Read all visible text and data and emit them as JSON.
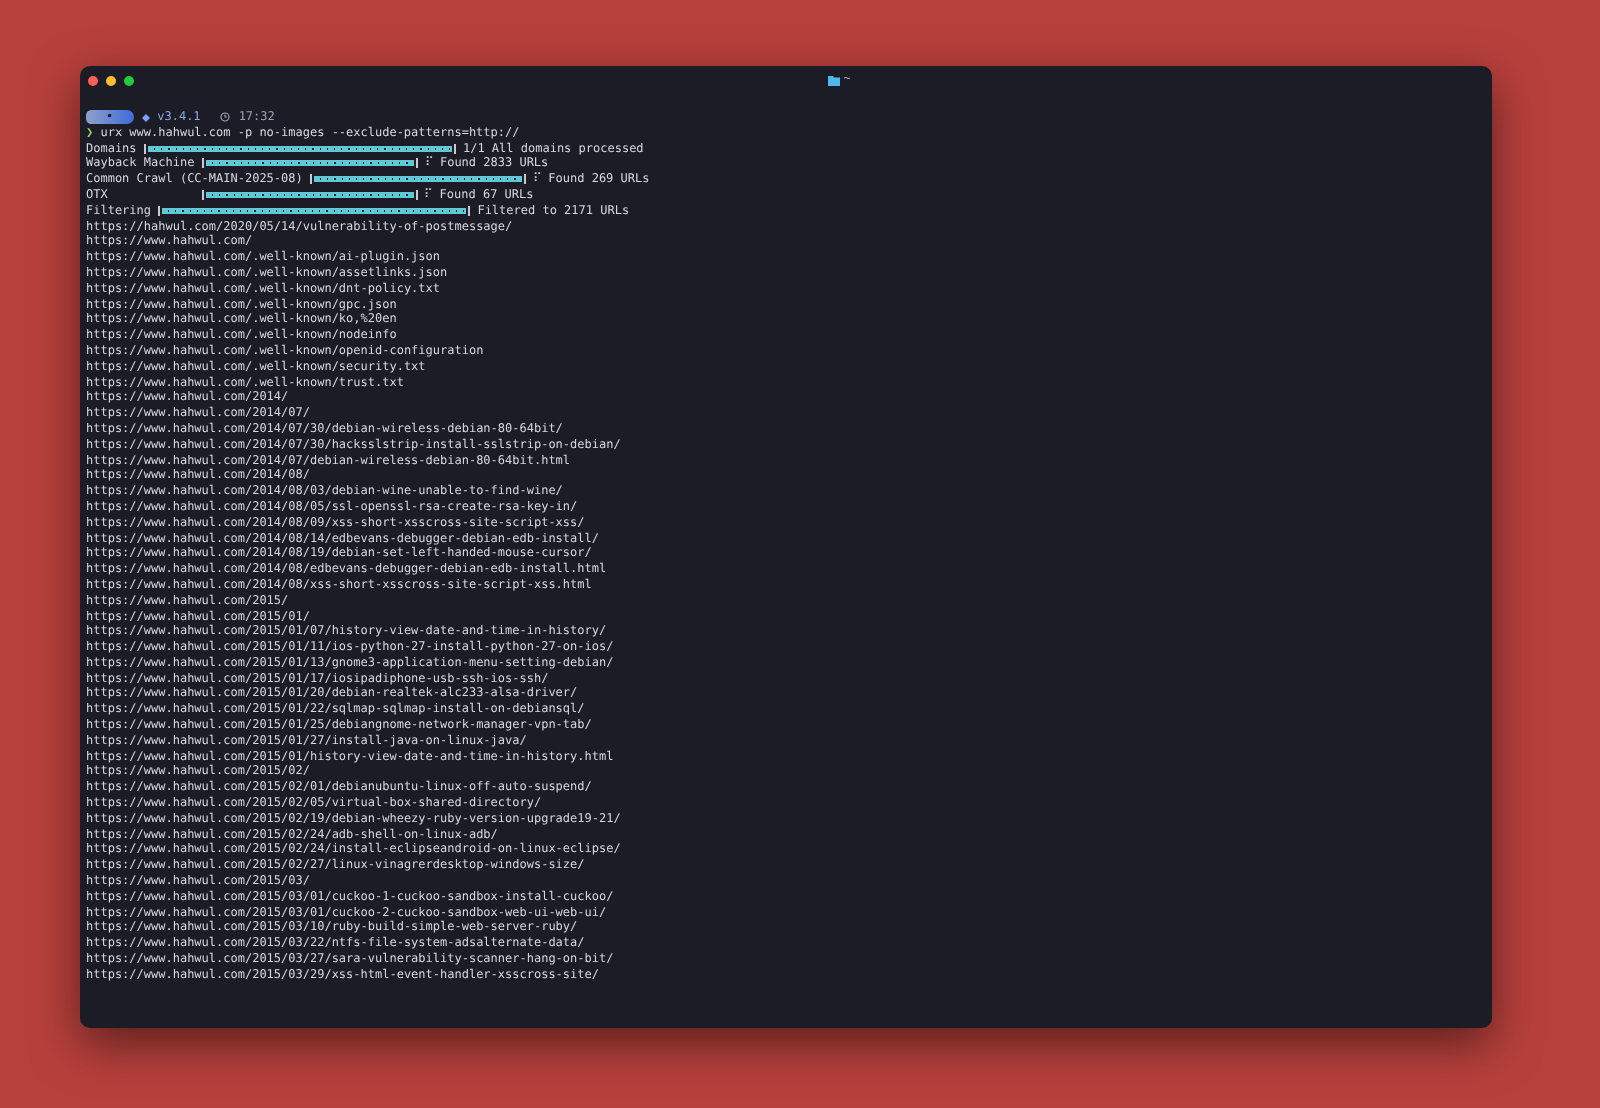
{
  "window": {
    "title": "~"
  },
  "prompt": {
    "segment": "•",
    "version": "v3.4.1",
    "time": "17:32",
    "symbol": "❯",
    "command": "urx www.hahwul.com -p no-images --exclude-patterns=http://"
  },
  "progress": [
    {
      "label": "Domains",
      "level": 1,
      "status": "1/1 All domains processed"
    },
    {
      "label": "Wayback Machine",
      "level": 1,
      "spinner": "⠏",
      "status": "Found 2833 URLs"
    },
    {
      "label": "Common Crawl (CC-MAIN-2025-08)",
      "level": 1,
      "spinner": "⠏",
      "status": "Found 269 URLs"
    },
    {
      "label": "OTX",
      "level": 1,
      "spinner": "⠏",
      "status": "Found 67 URLs"
    },
    {
      "label": "Filtering",
      "level": 1,
      "status": "Filtered to 2171 URLs"
    }
  ],
  "urls": [
    "https://hahwul.com/2020/05/14/vulnerability-of-postmessage/",
    "https://www.hahwul.com/",
    "https://www.hahwul.com/.well-known/ai-plugin.json",
    "https://www.hahwul.com/.well-known/assetlinks.json",
    "https://www.hahwul.com/.well-known/dnt-policy.txt",
    "https://www.hahwul.com/.well-known/gpc.json",
    "https://www.hahwul.com/.well-known/ko,%20en",
    "https://www.hahwul.com/.well-known/nodeinfo",
    "https://www.hahwul.com/.well-known/openid-configuration",
    "https://www.hahwul.com/.well-known/security.txt",
    "https://www.hahwul.com/.well-known/trust.txt",
    "https://www.hahwul.com/2014/",
    "https://www.hahwul.com/2014/07/",
    "https://www.hahwul.com/2014/07/30/debian-wireless-debian-80-64bit/",
    "https://www.hahwul.com/2014/07/30/hacksslstrip-install-sslstrip-on-debian/",
    "https://www.hahwul.com/2014/07/debian-wireless-debian-80-64bit.html",
    "https://www.hahwul.com/2014/08/",
    "https://www.hahwul.com/2014/08/03/debian-wine-unable-to-find-wine/",
    "https://www.hahwul.com/2014/08/05/ssl-openssl-rsa-create-rsa-key-in/",
    "https://www.hahwul.com/2014/08/09/xss-short-xsscross-site-script-xss/",
    "https://www.hahwul.com/2014/08/14/edbevans-debugger-debian-edb-install/",
    "https://www.hahwul.com/2014/08/19/debian-set-left-handed-mouse-cursor/",
    "https://www.hahwul.com/2014/08/edbevans-debugger-debian-edb-install.html",
    "https://www.hahwul.com/2014/08/xss-short-xsscross-site-script-xss.html",
    "https://www.hahwul.com/2015/",
    "https://www.hahwul.com/2015/01/",
    "https://www.hahwul.com/2015/01/07/history-view-date-and-time-in-history/",
    "https://www.hahwul.com/2015/01/11/ios-python-27-install-python-27-on-ios/",
    "https://www.hahwul.com/2015/01/13/gnome3-application-menu-setting-debian/",
    "https://www.hahwul.com/2015/01/17/iosipadiphone-usb-ssh-ios-ssh/",
    "https://www.hahwul.com/2015/01/20/debian-realtek-alc233-alsa-driver/",
    "https://www.hahwul.com/2015/01/22/sqlmap-sqlmap-install-on-debiansql/",
    "https://www.hahwul.com/2015/01/25/debiangnome-network-manager-vpn-tab/",
    "https://www.hahwul.com/2015/01/27/install-java-on-linux-java/",
    "https://www.hahwul.com/2015/01/history-view-date-and-time-in-history.html",
    "https://www.hahwul.com/2015/02/",
    "https://www.hahwul.com/2015/02/01/debianubuntu-linux-off-auto-suspend/",
    "https://www.hahwul.com/2015/02/05/virtual-box-shared-directory/",
    "https://www.hahwul.com/2015/02/19/debian-wheezy-ruby-version-upgrade19-21/",
    "https://www.hahwul.com/2015/02/24/adb-shell-on-linux-adb/",
    "https://www.hahwul.com/2015/02/24/install-eclipseandroid-on-linux-eclipse/",
    "https://www.hahwul.com/2015/02/27/linux-vinagrerdesktop-windows-size/",
    "https://www.hahwul.com/2015/03/",
    "https://www.hahwul.com/2015/03/01/cuckoo-1-cuckoo-sandbox-install-cuckoo/",
    "https://www.hahwul.com/2015/03/01/cuckoo-2-cuckoo-sandbox-web-ui-web-ui/",
    "https://www.hahwul.com/2015/03/10/ruby-build-simple-web-server-ruby/",
    "https://www.hahwul.com/2015/03/22/ntfs-file-system-adsalternate-data/",
    "https://www.hahwul.com/2015/03/27/sara-vulnerability-scanner-hang-on-bit/",
    "https://www.hahwul.com/2015/03/29/xss-html-event-handler-xsscross-site/"
  ]
}
